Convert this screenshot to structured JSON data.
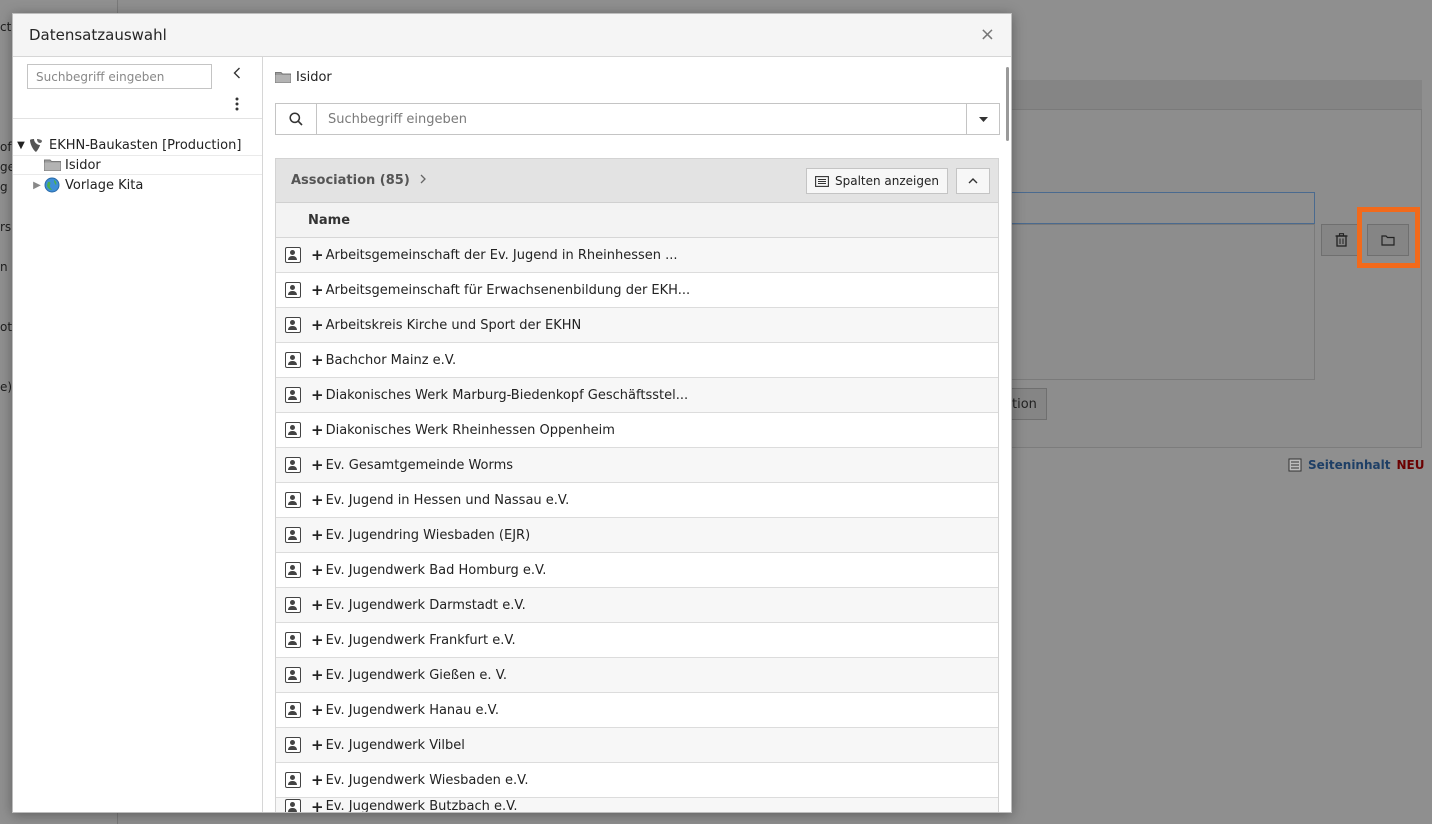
{
  "modal": {
    "title": "Datensatzauswahl",
    "close": "×"
  },
  "tree": {
    "search_placeholder": "Suchbegriff eingeben",
    "collapse_icon": "chevron-left-icon",
    "menu_icon": "kebab-menu-icon",
    "nodes": [
      {
        "toggle": "▼",
        "label": "EKHN-Baukasten [Production]",
        "icon": "typo3-logo-icon"
      },
      {
        "toggle": "",
        "label": "Isidor",
        "icon": "folder-icon",
        "selected": true
      },
      {
        "toggle": "▶",
        "label": "Vorlage Kita",
        "icon": "globe-icon"
      }
    ]
  },
  "list": {
    "breadcrumb": "Isidor",
    "search_placeholder": "Suchbegriff eingeben",
    "table_title": "Association (85)",
    "show_columns_label": "Spalten anzeigen",
    "column_name": "Name",
    "rows": [
      "Arbeitsgemeinschaft der Ev. Jugend in Rheinhessen ...",
      "Arbeitsgemeinschaft für Erwachsenenbildung der EKH...",
      "Arbeitskreis Kirche und Sport der EKHN",
      "Bachchor Mainz e.V.",
      "Diakonisches Werk Marburg-Biedenkopf Geschäftsstel...",
      "Diakonisches Werk Rheinhessen Oppenheim",
      "Ev. Gesamtgemeinde Worms",
      "Ev. Jugend in Hessen und Nassau e.V.",
      "Ev. Jugendring Wiesbaden (EJR)",
      "Ev. Jugendwerk Bad Homburg e.V.",
      "Ev. Jugendwerk Darmstadt e.V.",
      "Ev. Jugendwerk Frankfurt e.V.",
      "Ev. Jugendwerk Gießen e. V.",
      "Ev. Jugendwerk Hanau e.V.",
      "Ev. Jugendwerk Vilbel",
      "Ev. Jugendwerk Wiesbaden e.V.",
      "Ev. Jugendwerk Butzbach e.V."
    ]
  },
  "background": {
    "left_fragments": [
      "ct",
      "of",
      "ge",
      "g",
      "rs",
      "n",
      "ote",
      "e)"
    ],
    "button_fragment": "tion",
    "seiteninhalt": "Seiteninhalt",
    "neu": "NEU"
  },
  "colors": {
    "highlight": "#f26a1b",
    "link_blue": "#1e3f66",
    "neu_red": "#6b0000"
  }
}
